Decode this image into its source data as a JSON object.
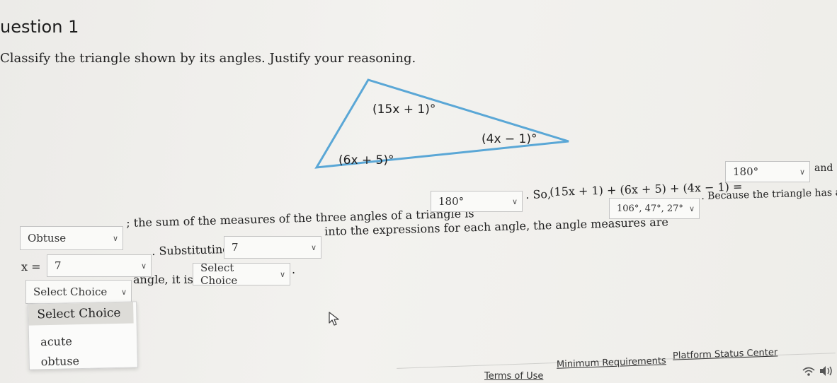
{
  "question": {
    "title": "uestion 1",
    "prompt": "Classify the triangle shown by its angles. Justify your reasoning."
  },
  "triangle": {
    "angle_top": "(15x + 1)°",
    "angle_right": "(4x − 1)°",
    "angle_left": "(6x + 5)°"
  },
  "answer": {
    "classification": "Obtuse",
    "text_sum": "; the sum of the measures of the three angles of a triangle is",
    "sum_value": "180°",
    "text_so": ". So,",
    "equation": "(15x + 1) + (6x + 5) + (4x − 1) =",
    "equation_value": "180°",
    "text_and": "and",
    "x_label": "x =",
    "x_value": "7",
    "text_substituting": ". Substituting",
    "substitute_value": "7",
    "text_into": "into the expressions for each angle, the angle measures are",
    "angle_measures": "106°, 47°, 27°",
    "text_because": ". Because the triangle has an",
    "angle_type": "Select Choice",
    "text_angle_it_is": "angle, it is",
    "triangle_type": "Select Choice",
    "text_period": "."
  },
  "dropdown": {
    "header": "Select Choice",
    "options": [
      "acute",
      "obtuse"
    ]
  },
  "footer": {
    "terms": "Terms of Use",
    "requirements": "Minimum Requirements",
    "status": "Platform Status Center"
  }
}
